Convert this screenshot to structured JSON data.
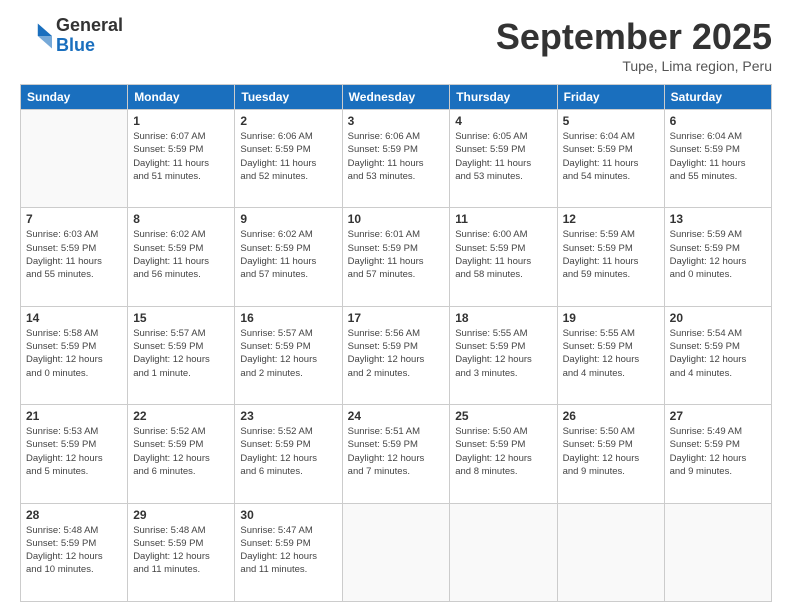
{
  "logo": {
    "general": "General",
    "blue": "Blue"
  },
  "header": {
    "month": "September 2025",
    "location": "Tupe, Lima region, Peru"
  },
  "weekdays": [
    "Sunday",
    "Monday",
    "Tuesday",
    "Wednesday",
    "Thursday",
    "Friday",
    "Saturday"
  ],
  "weeks": [
    [
      {
        "day": "",
        "info": ""
      },
      {
        "day": "1",
        "info": "Sunrise: 6:07 AM\nSunset: 5:59 PM\nDaylight: 11 hours\nand 51 minutes."
      },
      {
        "day": "2",
        "info": "Sunrise: 6:06 AM\nSunset: 5:59 PM\nDaylight: 11 hours\nand 52 minutes."
      },
      {
        "day": "3",
        "info": "Sunrise: 6:06 AM\nSunset: 5:59 PM\nDaylight: 11 hours\nand 53 minutes."
      },
      {
        "day": "4",
        "info": "Sunrise: 6:05 AM\nSunset: 5:59 PM\nDaylight: 11 hours\nand 53 minutes."
      },
      {
        "day": "5",
        "info": "Sunrise: 6:04 AM\nSunset: 5:59 PM\nDaylight: 11 hours\nand 54 minutes."
      },
      {
        "day": "6",
        "info": "Sunrise: 6:04 AM\nSunset: 5:59 PM\nDaylight: 11 hours\nand 55 minutes."
      }
    ],
    [
      {
        "day": "7",
        "info": "Sunrise: 6:03 AM\nSunset: 5:59 PM\nDaylight: 11 hours\nand 55 minutes."
      },
      {
        "day": "8",
        "info": "Sunrise: 6:02 AM\nSunset: 5:59 PM\nDaylight: 11 hours\nand 56 minutes."
      },
      {
        "day": "9",
        "info": "Sunrise: 6:02 AM\nSunset: 5:59 PM\nDaylight: 11 hours\nand 57 minutes."
      },
      {
        "day": "10",
        "info": "Sunrise: 6:01 AM\nSunset: 5:59 PM\nDaylight: 11 hours\nand 57 minutes."
      },
      {
        "day": "11",
        "info": "Sunrise: 6:00 AM\nSunset: 5:59 PM\nDaylight: 11 hours\nand 58 minutes."
      },
      {
        "day": "12",
        "info": "Sunrise: 5:59 AM\nSunset: 5:59 PM\nDaylight: 11 hours\nand 59 minutes."
      },
      {
        "day": "13",
        "info": "Sunrise: 5:59 AM\nSunset: 5:59 PM\nDaylight: 12 hours\nand 0 minutes."
      }
    ],
    [
      {
        "day": "14",
        "info": "Sunrise: 5:58 AM\nSunset: 5:59 PM\nDaylight: 12 hours\nand 0 minutes."
      },
      {
        "day": "15",
        "info": "Sunrise: 5:57 AM\nSunset: 5:59 PM\nDaylight: 12 hours\nand 1 minute."
      },
      {
        "day": "16",
        "info": "Sunrise: 5:57 AM\nSunset: 5:59 PM\nDaylight: 12 hours\nand 2 minutes."
      },
      {
        "day": "17",
        "info": "Sunrise: 5:56 AM\nSunset: 5:59 PM\nDaylight: 12 hours\nand 2 minutes."
      },
      {
        "day": "18",
        "info": "Sunrise: 5:55 AM\nSunset: 5:59 PM\nDaylight: 12 hours\nand 3 minutes."
      },
      {
        "day": "19",
        "info": "Sunrise: 5:55 AM\nSunset: 5:59 PM\nDaylight: 12 hours\nand 4 minutes."
      },
      {
        "day": "20",
        "info": "Sunrise: 5:54 AM\nSunset: 5:59 PM\nDaylight: 12 hours\nand 4 minutes."
      }
    ],
    [
      {
        "day": "21",
        "info": "Sunrise: 5:53 AM\nSunset: 5:59 PM\nDaylight: 12 hours\nand 5 minutes."
      },
      {
        "day": "22",
        "info": "Sunrise: 5:52 AM\nSunset: 5:59 PM\nDaylight: 12 hours\nand 6 minutes."
      },
      {
        "day": "23",
        "info": "Sunrise: 5:52 AM\nSunset: 5:59 PM\nDaylight: 12 hours\nand 6 minutes."
      },
      {
        "day": "24",
        "info": "Sunrise: 5:51 AM\nSunset: 5:59 PM\nDaylight: 12 hours\nand 7 minutes."
      },
      {
        "day": "25",
        "info": "Sunrise: 5:50 AM\nSunset: 5:59 PM\nDaylight: 12 hours\nand 8 minutes."
      },
      {
        "day": "26",
        "info": "Sunrise: 5:50 AM\nSunset: 5:59 PM\nDaylight: 12 hours\nand 9 minutes."
      },
      {
        "day": "27",
        "info": "Sunrise: 5:49 AM\nSunset: 5:59 PM\nDaylight: 12 hours\nand 9 minutes."
      }
    ],
    [
      {
        "day": "28",
        "info": "Sunrise: 5:48 AM\nSunset: 5:59 PM\nDaylight: 12 hours\nand 10 minutes."
      },
      {
        "day": "29",
        "info": "Sunrise: 5:48 AM\nSunset: 5:59 PM\nDaylight: 12 hours\nand 11 minutes."
      },
      {
        "day": "30",
        "info": "Sunrise: 5:47 AM\nSunset: 5:59 PM\nDaylight: 12 hours\nand 11 minutes."
      },
      {
        "day": "",
        "info": ""
      },
      {
        "day": "",
        "info": ""
      },
      {
        "day": "",
        "info": ""
      },
      {
        "day": "",
        "info": ""
      }
    ]
  ]
}
